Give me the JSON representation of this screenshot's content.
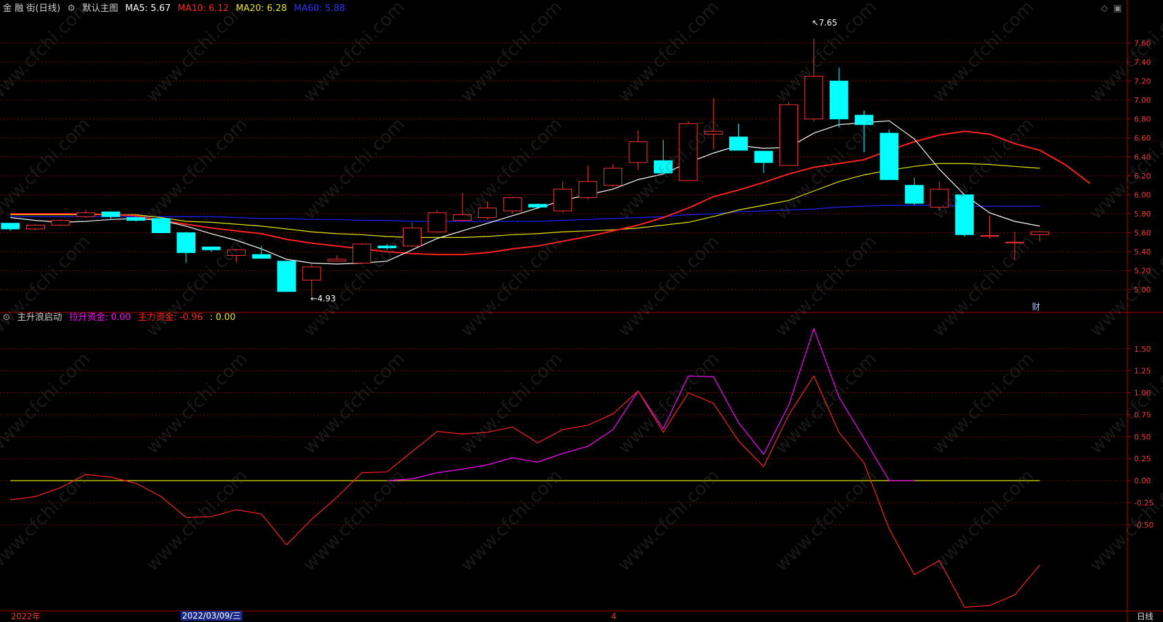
{
  "header_main": {
    "title": "金 融 街(日线)",
    "indicator_name": "默认主图",
    "ma5": "MA5: 5.67",
    "ma10": "MA10: 6.12",
    "ma20": "MA20: 6.28",
    "ma60": "MA60: 5.88"
  },
  "header_sub": {
    "name": "主升浪启动",
    "lsz": "拉升资金: 0.00",
    "zlz": "主力资金: -0.96",
    "extra": ": 0.00"
  },
  "price_axis": [
    "7.60",
    "7.40",
    "7.20",
    "7.00",
    "6.80",
    "6.60",
    "6.40",
    "6.20",
    "6.00",
    "5.80",
    "5.60",
    "5.40",
    "5.20",
    "5.00"
  ],
  "osc_axis": [
    "1.50",
    "1.25",
    "1.00",
    "0.75",
    "0.50",
    "0.25",
    "0.00",
    "-0.25",
    "-0.50"
  ],
  "annotations": {
    "high": "7.65",
    "low": "4.93",
    "cai": "财"
  },
  "bottom_bar": {
    "year": "2022年",
    "cursor_date": "2022/03/09/三",
    "month": "4",
    "period": "日线"
  },
  "watermark": "www.cfchi.com",
  "colors": {
    "up": "#ff3232",
    "down": "#00ffff",
    "ma5": "#ffffff",
    "ma10": "#ff2020",
    "ma20": "#e6e600",
    "ma60": "#2020ff",
    "lsz": "#ff00ff",
    "zlz": "#ff2020",
    "zero": "#e6e600",
    "grid": "#7a0000"
  },
  "chart_data": {
    "type": "candlestick",
    "price_range": [
      4.85,
      7.72
    ],
    "candles": [
      {
        "o": 5.7,
        "h": 5.7,
        "l": 5.62,
        "c": 5.64
      },
      {
        "o": 5.64,
        "h": 5.69,
        "l": 5.63,
        "c": 5.68
      },
      {
        "o": 5.68,
        "h": 5.74,
        "l": 5.67,
        "c": 5.73
      },
      {
        "o": 5.77,
        "h": 5.84,
        "l": 5.76,
        "c": 5.81
      },
      {
        "o": 5.82,
        "h": 5.82,
        "l": 5.75,
        "c": 5.77
      },
      {
        "o": 5.76,
        "h": 5.77,
        "l": 5.72,
        "c": 5.73
      },
      {
        "o": 5.75,
        "h": 5.75,
        "l": 5.6,
        "c": 5.6
      },
      {
        "o": 5.6,
        "h": 5.61,
        "l": 5.28,
        "c": 5.39
      },
      {
        "o": 5.45,
        "h": 5.45,
        "l": 5.4,
        "c": 5.42
      },
      {
        "o": 5.36,
        "h": 5.43,
        "l": 5.29,
        "c": 5.42
      },
      {
        "o": 5.37,
        "h": 5.46,
        "l": 5.33,
        "c": 5.33
      },
      {
        "o": 5.3,
        "h": 5.3,
        "l": 4.98,
        "c": 4.98
      },
      {
        "o": 5.1,
        "h": 5.27,
        "l": 4.93,
        "c": 5.24
      },
      {
        "o": 5.3,
        "h": 5.36,
        "l": 5.3,
        "c": 5.32
      },
      {
        "o": 5.28,
        "h": 5.49,
        "l": 5.27,
        "c": 5.48
      },
      {
        "o": 5.46,
        "h": 5.48,
        "l": 5.42,
        "c": 5.44
      },
      {
        "o": 5.46,
        "h": 5.71,
        "l": 5.45,
        "c": 5.65
      },
      {
        "o": 5.61,
        "h": 5.84,
        "l": 5.6,
        "c": 5.81
      },
      {
        "o": 5.73,
        "h": 6.02,
        "l": 5.72,
        "c": 5.79
      },
      {
        "o": 5.76,
        "h": 5.93,
        "l": 5.74,
        "c": 5.86
      },
      {
        "o": 5.83,
        "h": 5.98,
        "l": 5.8,
        "c": 5.97
      },
      {
        "o": 5.9,
        "h": 5.91,
        "l": 5.85,
        "c": 5.87
      },
      {
        "o": 5.83,
        "h": 6.14,
        "l": 5.81,
        "c": 6.06
      },
      {
        "o": 5.97,
        "h": 6.31,
        "l": 5.95,
        "c": 6.14
      },
      {
        "o": 6.1,
        "h": 6.32,
        "l": 6.08,
        "c": 6.28
      },
      {
        "o": 6.34,
        "h": 6.68,
        "l": 6.26,
        "c": 6.56
      },
      {
        "o": 6.36,
        "h": 6.58,
        "l": 6.24,
        "c": 6.23
      },
      {
        "o": 6.15,
        "h": 6.78,
        "l": 6.15,
        "c": 6.75
      },
      {
        "o": 6.64,
        "h": 7.02,
        "l": 6.48,
        "c": 6.67
      },
      {
        "o": 6.61,
        "h": 6.75,
        "l": 6.48,
        "c": 6.47
      },
      {
        "o": 6.46,
        "h": 6.46,
        "l": 6.23,
        "c": 6.34
      },
      {
        "o": 6.31,
        "h": 6.98,
        "l": 6.31,
        "c": 6.95
      },
      {
        "o": 6.8,
        "h": 7.65,
        "l": 6.77,
        "c": 7.25
      },
      {
        "o": 7.2,
        "h": 7.34,
        "l": 6.71,
        "c": 6.8
      },
      {
        "o": 6.84,
        "h": 6.89,
        "l": 6.45,
        "c": 6.74
      },
      {
        "o": 6.65,
        "h": 6.69,
        "l": 6.16,
        "c": 6.16
      },
      {
        "o": 6.1,
        "h": 6.18,
        "l": 5.89,
        "c": 5.91
      },
      {
        "o": 5.87,
        "h": 6.14,
        "l": 5.84,
        "c": 6.06
      },
      {
        "o": 6.0,
        "h": 6.0,
        "l": 5.56,
        "c": 5.58
      },
      {
        "o": 5.57,
        "h": 5.78,
        "l": 5.54,
        "c": 5.57
      },
      {
        "o": 5.5,
        "h": 5.61,
        "l": 5.31,
        "c": 5.5
      },
      {
        "o": 5.58,
        "h": 5.62,
        "l": 5.51,
        "c": 5.61
      }
    ],
    "ma5": [
      5.76,
      5.73,
      5.71,
      5.72,
      5.74,
      5.75,
      5.73,
      5.67,
      5.59,
      5.52,
      5.43,
      5.32,
      5.28,
      5.27,
      5.28,
      5.3,
      5.42,
      5.54,
      5.62,
      5.7,
      5.78,
      5.86,
      5.94,
      6.0,
      6.06,
      6.16,
      6.22,
      6.34,
      6.44,
      6.52,
      6.49,
      6.5,
      6.65,
      6.74,
      6.76,
      6.78,
      6.59,
      6.27,
      6.0,
      5.81,
      5.72,
      5.67
    ],
    "ma10": [
      5.8,
      5.8,
      5.8,
      5.8,
      5.79,
      5.78,
      5.73,
      5.69,
      5.65,
      5.62,
      5.59,
      5.53,
      5.49,
      5.46,
      5.43,
      5.4,
      5.38,
      5.37,
      5.37,
      5.39,
      5.43,
      5.46,
      5.51,
      5.56,
      5.62,
      5.68,
      5.76,
      5.86,
      5.98,
      6.05,
      6.13,
      6.22,
      6.29,
      6.33,
      6.37,
      6.47,
      6.56,
      6.63,
      6.67,
      6.64,
      6.54,
      6.47,
      6.32,
      6.12
    ],
    "ma20": [
      5.79,
      5.79,
      5.79,
      5.79,
      5.79,
      5.79,
      5.76,
      5.72,
      5.71,
      5.69,
      5.67,
      5.64,
      5.61,
      5.59,
      5.58,
      5.56,
      5.55,
      5.55,
      5.55,
      5.56,
      5.58,
      5.59,
      5.61,
      5.62,
      5.63,
      5.65,
      5.68,
      5.71,
      5.77,
      5.84,
      5.89,
      5.94,
      6.04,
      6.14,
      6.21,
      6.26,
      6.3,
      6.33,
      6.33,
      6.32,
      6.3,
      6.28
    ],
    "ma60": [
      5.77,
      5.77,
      5.77,
      5.77,
      5.77,
      5.77,
      5.77,
      5.77,
      5.77,
      5.76,
      5.75,
      5.75,
      5.74,
      5.74,
      5.73,
      5.73,
      5.72,
      5.72,
      5.72,
      5.72,
      5.72,
      5.72,
      5.73,
      5.74,
      5.75,
      5.76,
      5.77,
      5.79,
      5.8,
      5.82,
      5.83,
      5.84,
      5.85,
      5.87,
      5.88,
      5.89,
      5.89,
      5.89,
      5.88,
      5.88,
      5.88,
      5.88
    ],
    "osc_range": [
      -1.4,
      1.75
    ],
    "zlz": [
      -0.22,
      -0.18,
      -0.08,
      0.07,
      0.04,
      -0.03,
      -0.18,
      -0.42,
      -0.41,
      -0.33,
      -0.38,
      -0.73,
      -0.44,
      -0.19,
      0.09,
      0.1,
      0.33,
      0.56,
      0.53,
      0.55,
      0.61,
      0.43,
      0.58,
      0.63,
      0.76,
      1.02,
      0.55,
      1.0,
      0.88,
      0.45,
      0.16,
      0.75,
      1.19,
      0.55,
      0.2,
      -0.55,
      -1.07,
      -0.91,
      -1.44,
      -1.42,
      -1.3,
      -0.96
    ],
    "lsz_start": 15,
    "lsz": [
      0.0,
      0.02,
      0.09,
      0.13,
      0.18,
      0.26,
      0.21,
      0.31,
      0.39,
      0.58,
      1.02,
      0.59,
      1.19,
      1.18,
      0.66,
      0.3,
      0.86,
      1.73,
      0.95,
      0.48,
      0.0,
      0.0
    ],
    "zero_line": 0.0
  }
}
